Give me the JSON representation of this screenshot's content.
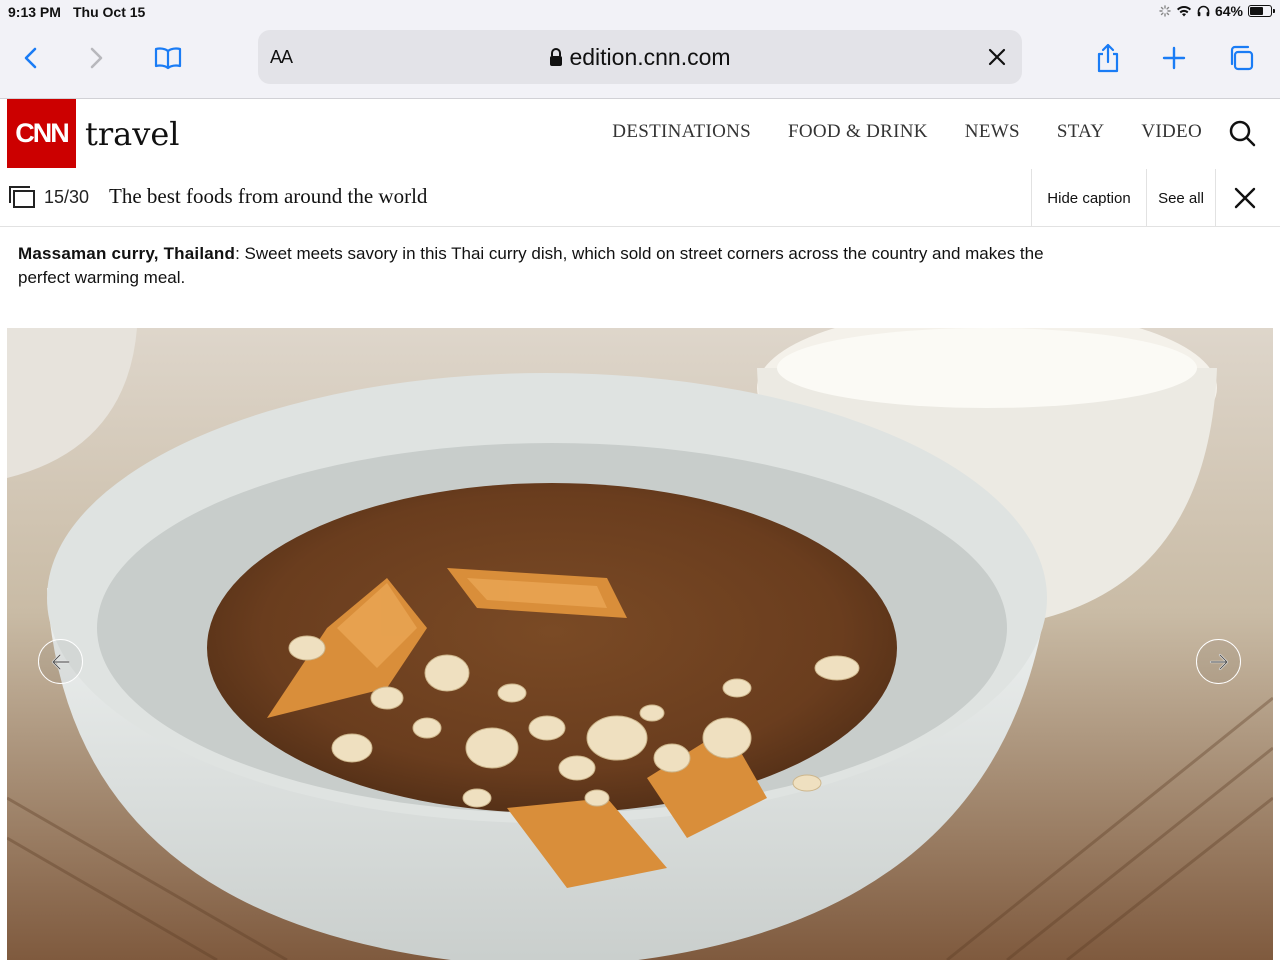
{
  "status_bar": {
    "time": "9:13 PM",
    "date": "Thu Oct 15",
    "battery": "64%",
    "battery_level": 0.64
  },
  "browser": {
    "text_size_label": "AA",
    "url": "edition.cnn.com"
  },
  "site": {
    "logo_text": "CNN",
    "section": "travel",
    "nav": [
      "DESTINATIONS",
      "FOOD & DRINK",
      "NEWS",
      "STAY",
      "VIDEO"
    ]
  },
  "gallery": {
    "counter": "15/30",
    "title": "The best foods from around the world",
    "hide_caption_label": "Hide caption",
    "see_all_label": "See all"
  },
  "caption": {
    "heading": "Massaman curry, Thailand",
    "text": ": Sweet meets savory in this Thai curry dish, which sold on street corners across the country and makes the perfect warming meal."
  },
  "colors": {
    "brand_red": "#cc0000",
    "ios_blue": "#1a7cf5",
    "toolbar_bg": "#f2f2f7"
  }
}
